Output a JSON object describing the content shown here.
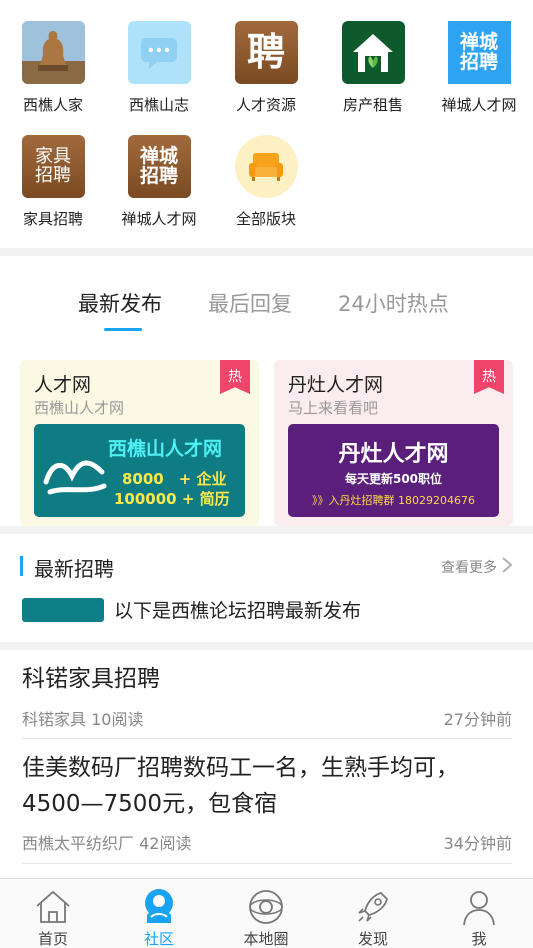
{
  "categories": [
    {
      "label": "西樵人家",
      "icon": "buddha-photo-icon"
    },
    {
      "label": "西樵山志",
      "icon": "chat-bubble-icon"
    },
    {
      "label": "人才资源",
      "icon_text": "聘"
    },
    {
      "label": "房产租售",
      "icon": "house-leaf-icon"
    },
    {
      "label": "禅城人才网",
      "icon_text": "禅城\n招聘"
    },
    {
      "label": "家具招聘",
      "icon_text": "家具\n招聘"
    },
    {
      "label": "禅城人才网",
      "icon_text": "禅城\n招聘"
    },
    {
      "label": "全部版块",
      "icon": "sofa-icon"
    }
  ],
  "tabs": [
    "最新发布",
    "最后回复",
    "24小时热点"
  ],
  "active_tab": 0,
  "cards": [
    {
      "title": "人才网",
      "subtitle": "西樵山人才网",
      "badge": "热",
      "banner_title": "西樵山人才网",
      "banner_line1": "8000　+ 企业",
      "banner_line2": "100000 + 简历"
    },
    {
      "title": "丹灶人才网",
      "subtitle": "马上来看看吧",
      "badge": "热",
      "banner_title": "丹灶人才网",
      "banner_line1": "每天更新500职位",
      "banner_line2": "》》入丹灶招聘群  18029204676"
    }
  ],
  "recruit": {
    "title": "最新招聘",
    "more": "查看更多",
    "message": "以下是西樵论坛招聘最新发布"
  },
  "posts": [
    {
      "title": "科锘家具招聘",
      "meta_left": "科锘家具 10阅读",
      "meta_right": "27分钟前"
    },
    {
      "title": "佳美数码厂招聘数码工一名，生熟手均可，4500—7500元，包食宿",
      "meta_left": "西樵太平纺织厂 42阅读",
      "meta_right": "34分钟前"
    }
  ],
  "nav": [
    {
      "label": "首页",
      "icon": "home-icon"
    },
    {
      "label": "社区",
      "icon": "community-icon"
    },
    {
      "label": "本地圈",
      "icon": "local-circle-icon"
    },
    {
      "label": "发现",
      "icon": "rocket-icon"
    },
    {
      "label": "我",
      "icon": "user-icon"
    }
  ],
  "colors": {
    "accent": "#1aa3f0",
    "hot": "#f0456a",
    "teal": "#0e7f86",
    "purple": "#5a1f7a"
  }
}
